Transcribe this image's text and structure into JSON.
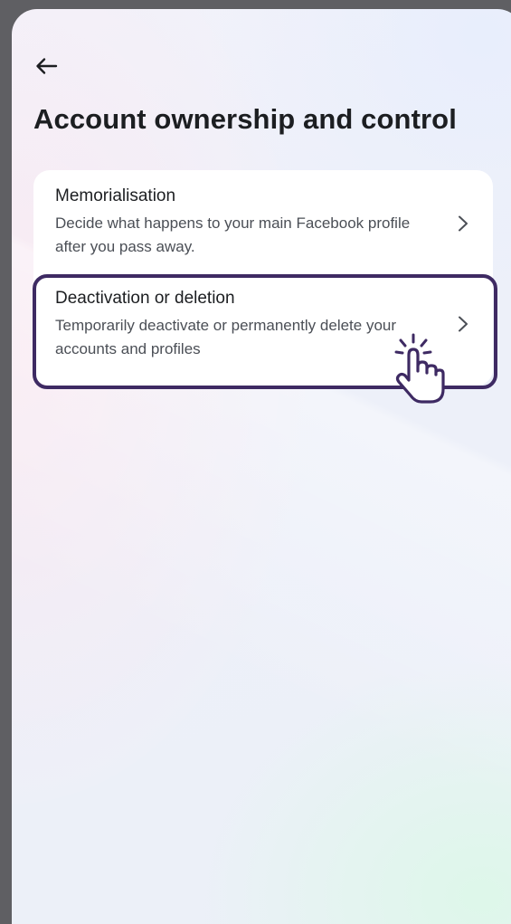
{
  "header": {
    "back_icon": "arrow-left-icon",
    "title": "Account ownership and control"
  },
  "settings": {
    "items": [
      {
        "title": "Memorialisation",
        "description": "Decide what happens to your main Facebook profile after you pass away.",
        "icon": "chevron-right-icon"
      },
      {
        "title": "Deactivation or deletion",
        "description": "Temporarily deactivate or permanently delete your accounts and profiles",
        "icon": "chevron-right-icon",
        "highlighted": true
      }
    ]
  },
  "overlay": {
    "pointer_icon": "hand-pointer-click-icon",
    "highlight_color": "#3e2a63"
  },
  "colors": {
    "title_text": "#1c1e21",
    "secondary_text": "#4b4f56",
    "card_background": "#ffffff"
  }
}
